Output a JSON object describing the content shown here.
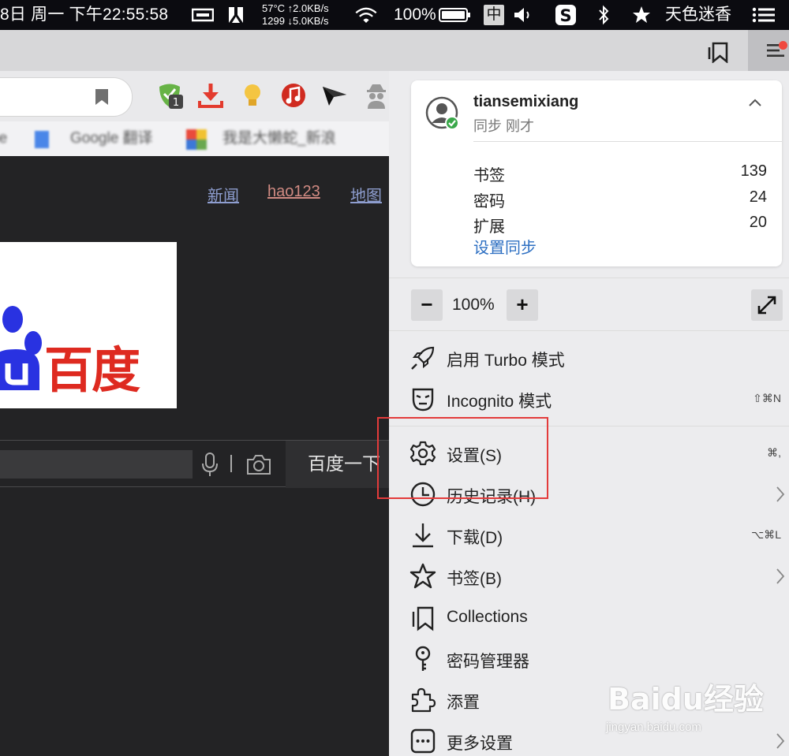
{
  "menubar": {
    "clock": "8日 周一 下午22:55:58",
    "net_up": "57°C ↑2.0KB/s",
    "net_down": "1299 ↓5.0KB/s",
    "battery": "100%",
    "ime": "中",
    "user": "天色迷香"
  },
  "bookmarks_bar": {
    "items": [
      "Google 翻译",
      "我是大懒蛇_新浪"
    ]
  },
  "extensions": {
    "badge_count": "1"
  },
  "page": {
    "links": [
      "新闻",
      "hao123",
      "地图"
    ],
    "logo_text": "百度",
    "search_button": "百度一下"
  },
  "sync": {
    "username": "tiansemixiang",
    "status": "同步 刚才",
    "stats": [
      {
        "label": "书签",
        "value": "139"
      },
      {
        "label": "密码",
        "value": "24"
      },
      {
        "label": "扩展",
        "value": "20"
      }
    ],
    "settings_link": "设置同步"
  },
  "zoom": {
    "minus": "−",
    "value": "100%",
    "plus": "+"
  },
  "menu": {
    "turbo": "启用 Turbo 模式",
    "incognito": "Incognito 模式",
    "incognito_shortcut": "⇧⌘N",
    "settings": "设置(S)",
    "settings_shortcut": "⌘,",
    "history": "历史记录(H)",
    "downloads": "下载(D)",
    "downloads_shortcut": "⌥⌘L",
    "bookmarks": "书签(B)",
    "collections": "Collections",
    "passwords": "密码管理器",
    "extensions": "添置",
    "more": "更多设置"
  },
  "watermark": {
    "brand": "Baidu经验",
    "url": "jingyan.baidu.com"
  },
  "colors": {
    "highlight": "#e33b3b",
    "link_blue": "#2d6fc2",
    "baidu_red": "#de2a20",
    "baidu_blue": "#2932e1"
  }
}
